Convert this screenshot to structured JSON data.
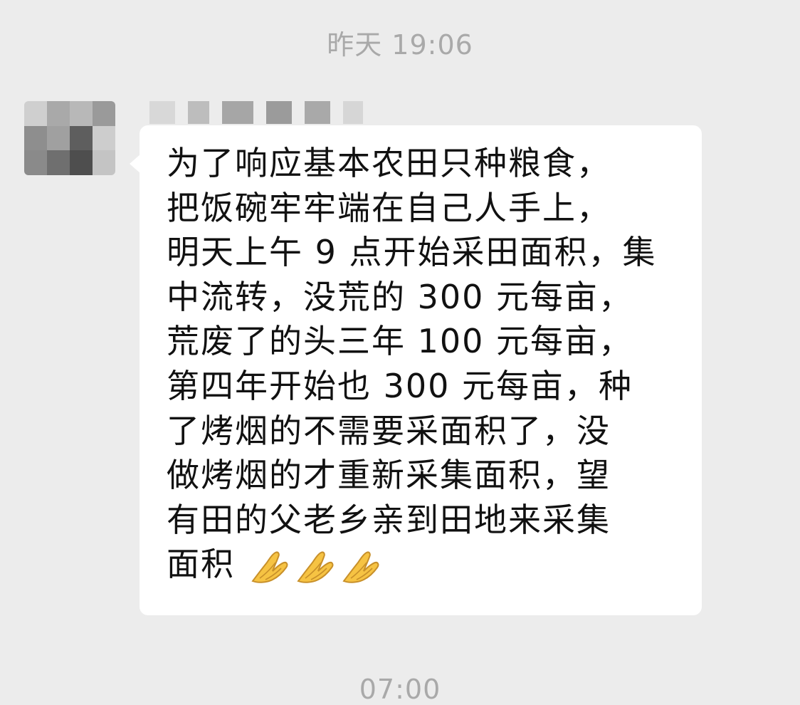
{
  "timestamps": {
    "top": "昨天 19:06",
    "bottom": "07:00"
  },
  "message": {
    "lines": [
      "为了响应基本农田只种粮食，",
      "把饭碗牢牢端在自己人手上，",
      "明天上午 9 点开始采田面积，集",
      "中流转，没荒的 300 元每亩，",
      "荒废了的头三年 100 元每亩，",
      "第四年开始也 300 元每亩，种",
      "了烤烟的不需要采面积了，没",
      "做烤烟的才重新采集面积，望",
      "有田的父老乡亲到田地来采集",
      "面积"
    ],
    "emoji": [
      "folded-hands",
      "folded-hands",
      "folded-hands"
    ]
  },
  "colors": {
    "background": "#ececec",
    "bubble": "#ffffff",
    "timestamp": "#a9a9a9",
    "text": "#111111"
  }
}
